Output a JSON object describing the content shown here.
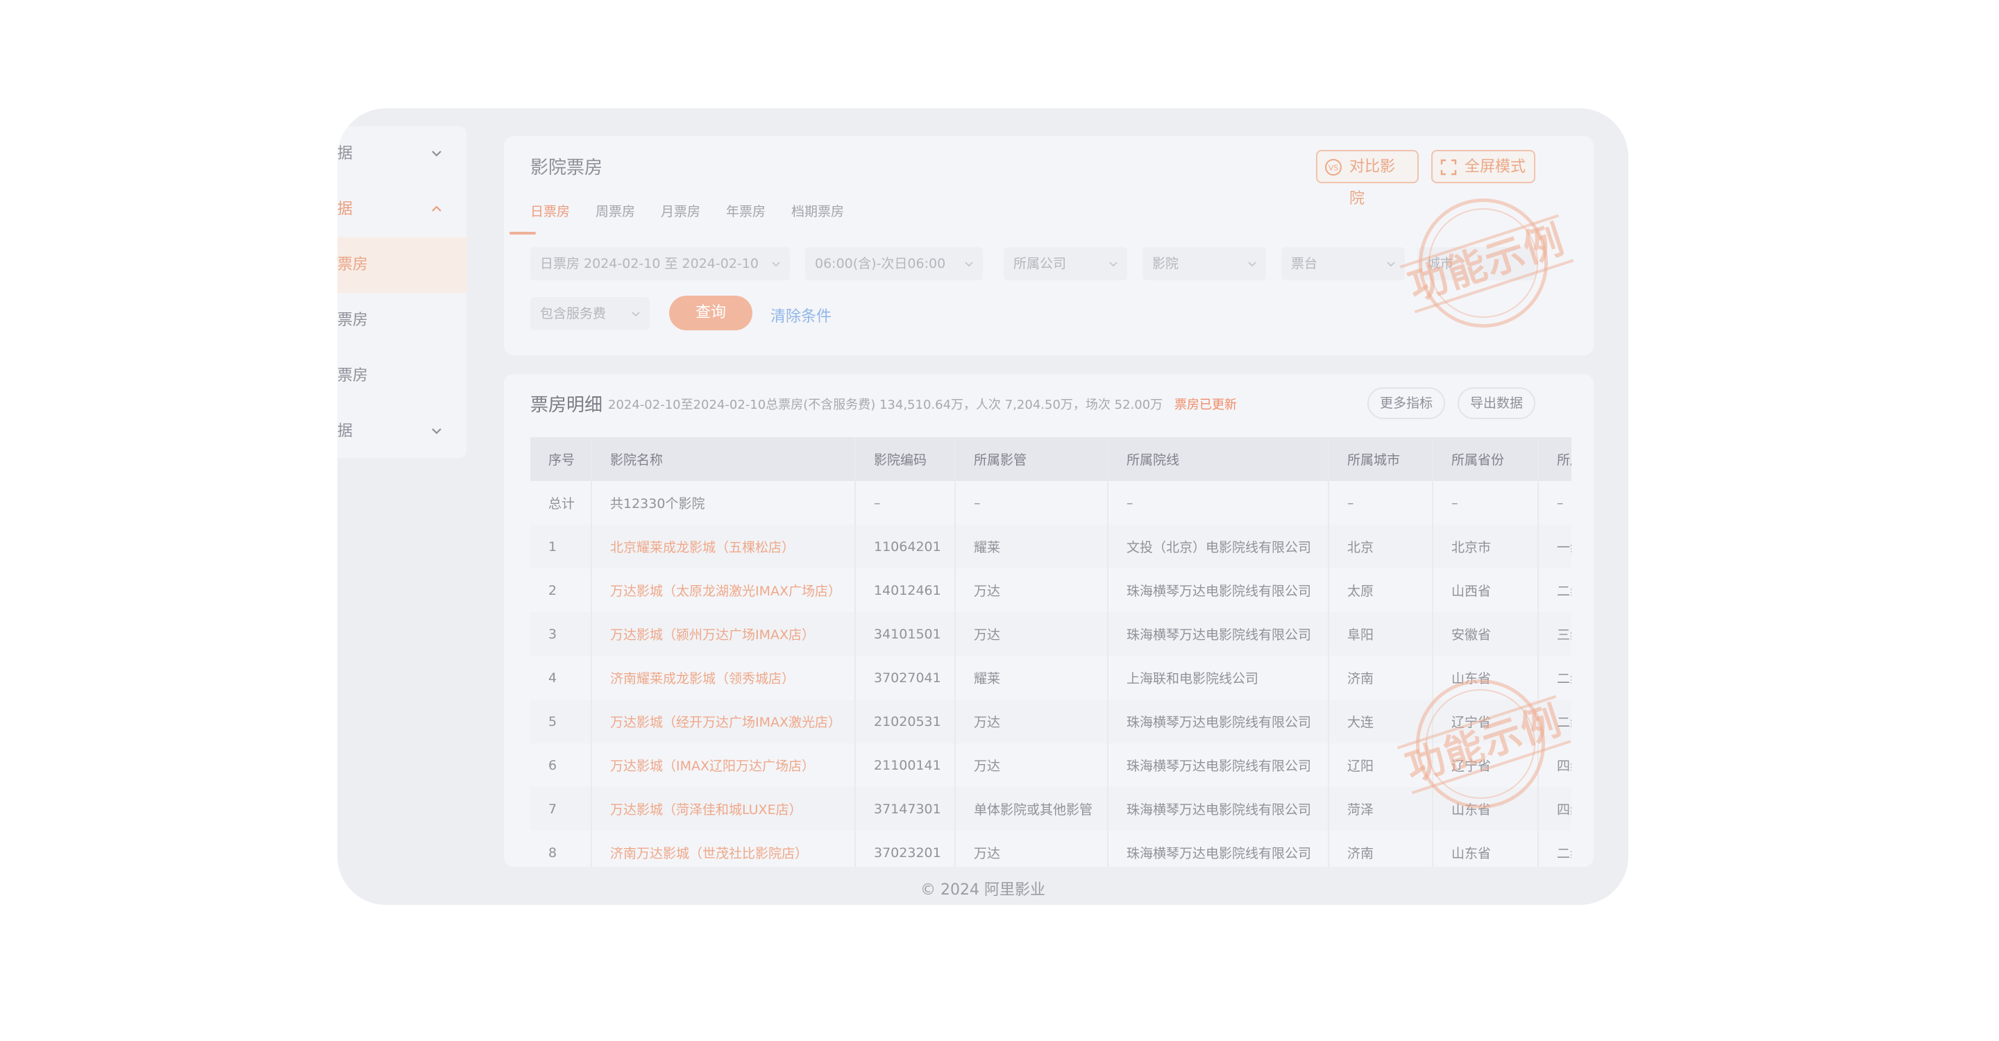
{
  "sidebar": {
    "items": [
      {
        "label": "据",
        "chevron": "down"
      },
      {
        "label": "据",
        "chevron": "up"
      },
      {
        "label": "票房",
        "active": true
      },
      {
        "label": "票房"
      },
      {
        "label": "票房"
      },
      {
        "label": "据",
        "chevron": "down"
      }
    ]
  },
  "header": {
    "title": "影院票房",
    "compare_label": "对比影院",
    "fullscreen_label": "全屏模式"
  },
  "tabs": [
    "日票房",
    "周票房",
    "月票房",
    "年票房",
    "档期票房"
  ],
  "filters": {
    "date_range": "日票房 2024-02-10 至 2024-02-10",
    "time_range": "06:00(含)-次日06:00",
    "company": "所属公司",
    "cinema": "影院",
    "hall": "票台",
    "city": "城市",
    "service_fee": "包含服务费",
    "query_label": "查询",
    "clear_label": "清除条件"
  },
  "watermark": "功能示例",
  "detail": {
    "title": "票房明细",
    "summary": "2024-02-10至2024-02-10总票房(不含服务费) 134,510.64万，人次 7,204.50万，场次 52.00万",
    "updated": "票房已更新",
    "more_label": "更多指标",
    "export_label": "导出数据",
    "columns": [
      "序号",
      "影院名称",
      "影院编码",
      "所属影管",
      "所属院线",
      "所属城市",
      "所属省份",
      "所属"
    ],
    "rows": [
      [
        "总计",
        "共12330个影院",
        "–",
        "–",
        "–",
        "–",
        "–",
        "–"
      ],
      [
        "1",
        "北京耀莱成龙影城（五棵松店）",
        "11064201",
        "耀莱",
        "文投（北京）电影院线有限公司",
        "北京",
        "北京市",
        "一线"
      ],
      [
        "2",
        "万达影城（太原龙湖激光IMAX广场店）",
        "14012461",
        "万达",
        "珠海横琴万达电影院线有限公司",
        "太原",
        "山西省",
        "二线"
      ],
      [
        "3",
        "万达影城（颍州万达广场IMAX店）",
        "34101501",
        "万达",
        "珠海横琴万达电影院线有限公司",
        "阜阳",
        "安徽省",
        "三线"
      ],
      [
        "4",
        "济南耀莱成龙影城（领秀城店）",
        "37027041",
        "耀莱",
        "上海联和电影院线公司",
        "济南",
        "山东省",
        "二线"
      ],
      [
        "5",
        "万达影城（经开万达广场IMAX激光店）",
        "21020531",
        "万达",
        "珠海横琴万达电影院线有限公司",
        "大连",
        "辽宁省",
        "二线"
      ],
      [
        "6",
        "万达影城（IMAX辽阳万达广场店）",
        "21100141",
        "万达",
        "珠海横琴万达电影院线有限公司",
        "辽阳",
        "辽宁省",
        "四线"
      ],
      [
        "7",
        "万达影城（菏泽佳和城LUXE店）",
        "37147301",
        "单体影院或其他影管",
        "珠海横琴万达电影院线有限公司",
        "菏泽",
        "山东省",
        "四线"
      ],
      [
        "8",
        "济南万达影城（世茂社比影院店）",
        "37023201",
        "万达",
        "珠海横琴万达电影院线有限公司",
        "济南",
        "山东省",
        "二线"
      ]
    ]
  },
  "footer": "© 2024 阿里影业"
}
